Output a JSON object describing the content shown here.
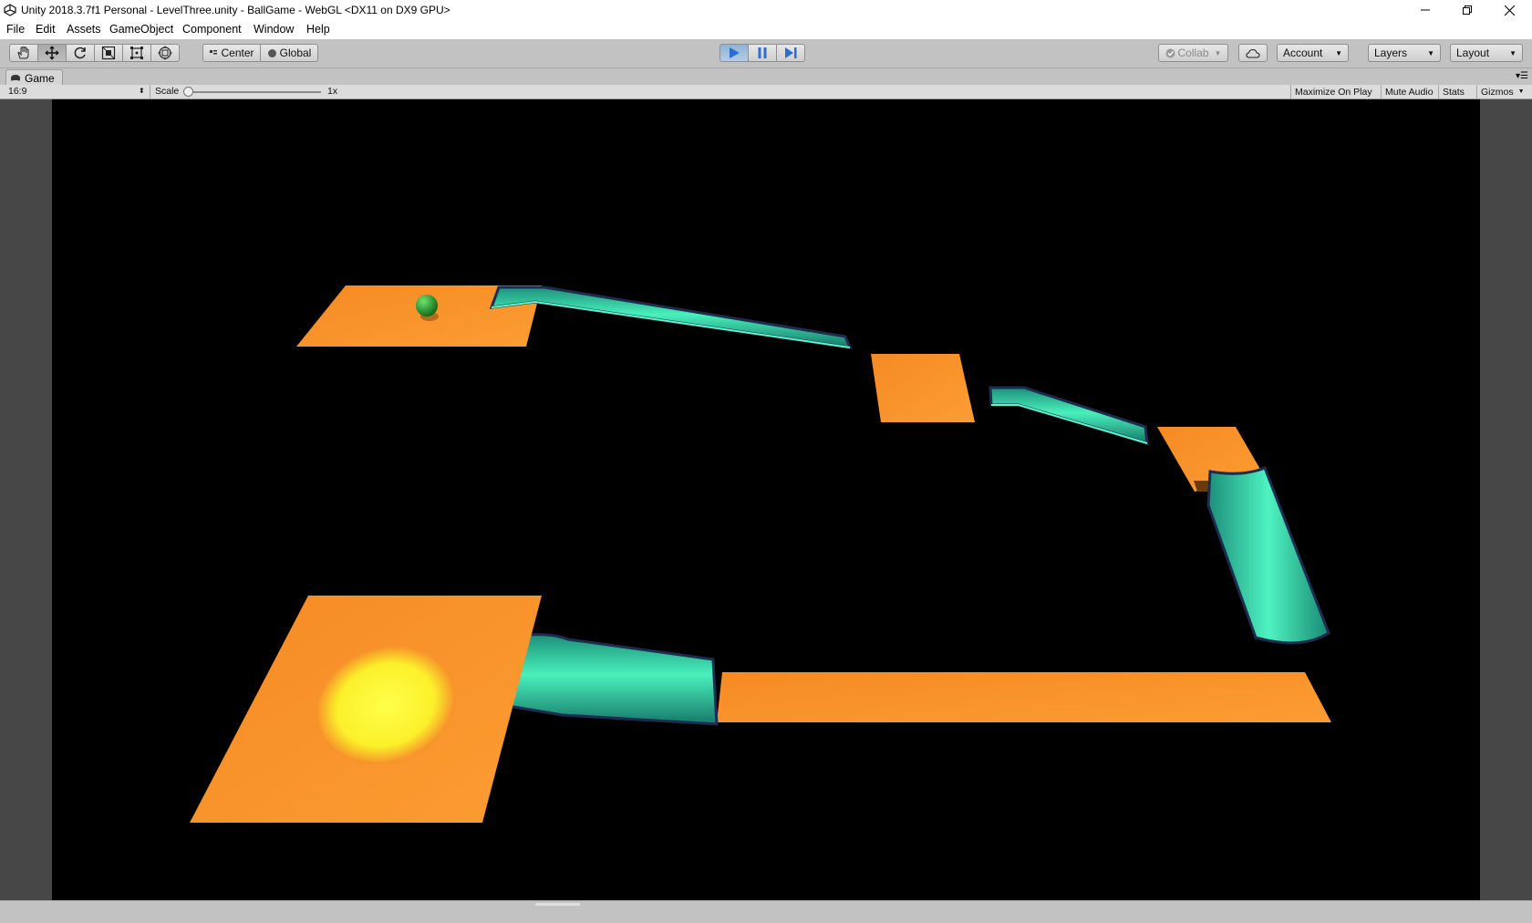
{
  "window": {
    "title": "Unity 2018.3.7f1 Personal - LevelThree.unity - BallGame - WebGL <DX11 on DX9 GPU>"
  },
  "menu": {
    "items": [
      "File",
      "Edit",
      "Assets",
      "GameObject",
      "Component",
      "Window",
      "Help"
    ]
  },
  "toolbar": {
    "tools": [
      "hand-icon",
      "move-icon",
      "rotate-icon",
      "scale-icon",
      "rect-icon",
      "transform-icon"
    ],
    "pivot_label": "Center",
    "space_label": "Global",
    "collab_label": "Collab",
    "account_label": "Account",
    "layers_label": "Layers",
    "layout_label": "Layout"
  },
  "game_tab": {
    "label": "Game"
  },
  "game_controls": {
    "aspect": "16:9",
    "scale_label": "Scale",
    "scale_value": "1x",
    "maximize_on_play": "Maximize On Play",
    "mute_audio": "Mute Audio",
    "stats": "Stats",
    "gizmos": "Gizmos"
  },
  "colors": {
    "platform": "#f7902a",
    "tube": "#3ee8b0",
    "ball": "#22a32a",
    "goal": "#ffff3a",
    "accent_play": "#4c8bd8"
  }
}
